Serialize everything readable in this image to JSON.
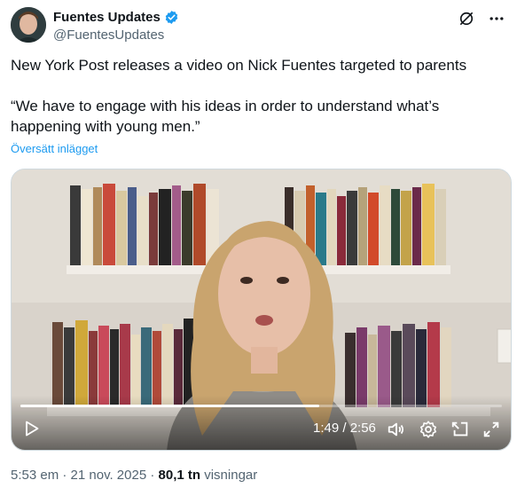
{
  "author": {
    "name": "Fuentes Updates",
    "handle": "@FuentesUpdates"
  },
  "tweet": {
    "line1": "New York Post releases a video on Nick Fuentes targeted to parents",
    "line2": "“We have to engage with his ideas in order to understand what’s happening with young men.”",
    "translate_label": "Översätt inlägget"
  },
  "video": {
    "time": "1:49 / 2:56",
    "progress": 0.62
  },
  "meta": {
    "timestamp": "5:53 em · 21 nov. 2025",
    "dot": " · ",
    "views_count": "80,1 tn",
    "views_label": " visningar"
  },
  "colors": {
    "verified": "#1d9bf0",
    "link": "#1d9bf0"
  }
}
